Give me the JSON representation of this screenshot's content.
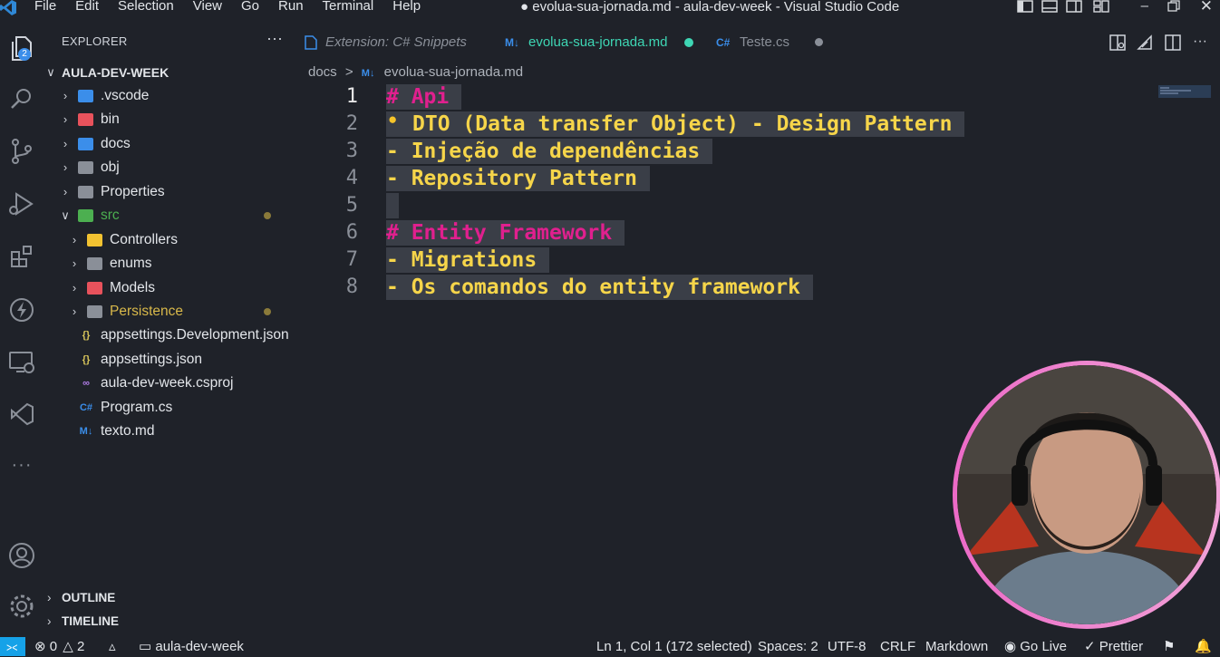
{
  "menu": [
    "File",
    "Edit",
    "Selection",
    "View",
    "Go",
    "Run",
    "Terminal",
    "Help"
  ],
  "window_title": "● evolua-sua-jornada.md - aula-dev-week - Visual Studio Code",
  "activity_badge": "2",
  "explorer": {
    "title": "EXPLORER",
    "more": "···",
    "root": "AULA-DEV-WEEK",
    "items": [
      {
        "label": ".vscode",
        "icon": "vscode-folder-icon",
        "color": "#3b8eea"
      },
      {
        "label": "bin",
        "icon": "bin-folder-icon",
        "color": "#e8525c"
      },
      {
        "label": "docs",
        "icon": "docs-folder-icon",
        "color": "#3b8eea"
      },
      {
        "label": "obj",
        "icon": "folder-icon",
        "color": "#8a8f98"
      },
      {
        "label": "Properties",
        "icon": "folder-icon",
        "color": "#8a8f98"
      },
      {
        "label": "src",
        "icon": "src-folder-icon",
        "color": "#4caf50"
      },
      {
        "label": "Controllers",
        "icon": "controllers-folder-icon",
        "color": "#f2c231"
      },
      {
        "label": "enums",
        "icon": "folder-icon",
        "color": "#8a8f98"
      },
      {
        "label": "Models",
        "icon": "models-folder-icon",
        "color": "#e8525c"
      },
      {
        "label": "Persistence",
        "icon": "folder-icon",
        "color": "#8a8f98"
      },
      {
        "label": "appsettings.Development.json",
        "icon": "json-icon",
        "color": "#d7c45a"
      },
      {
        "label": "appsettings.json",
        "icon": "json-icon",
        "color": "#d7c45a"
      },
      {
        "label": "aula-dev-week.csproj",
        "icon": "csproj-icon",
        "color": "#b27ee8"
      },
      {
        "label": "Program.cs",
        "icon": "csharp-icon",
        "color": "#3b8eea"
      },
      {
        "label": "texto.md",
        "icon": "markdown-icon",
        "color": "#3b8eea"
      }
    ],
    "outline": "OUTLINE",
    "timeline": "TIMELINE"
  },
  "tabs": [
    {
      "label": "Extension: C# Snippets",
      "icon": "extension-file-icon"
    },
    {
      "label": "evolua-sua-jornada.md",
      "icon": "markdown-icon",
      "prefix": "M↓"
    },
    {
      "label": "Teste.cs",
      "icon": "csharp-icon",
      "prefix": "C#"
    }
  ],
  "breadcrumb": {
    "folder": "docs",
    "sep": ">",
    "file": "evolua-sua-jornada.md",
    "prefix": "M↓"
  },
  "editor": {
    "lines": [
      {
        "n": "1",
        "text": "# Api",
        "kind": "heading"
      },
      {
        "n": "2",
        "text": "DTO (Data transfer Object) - Design Pattern",
        "kind": "plain"
      },
      {
        "n": "3",
        "text": "- Injeção de dependências",
        "kind": "plain"
      },
      {
        "n": "4",
        "text": "- Repository Pattern",
        "kind": "plain"
      },
      {
        "n": "5",
        "text": "",
        "kind": "plain"
      },
      {
        "n": "6",
        "text": "# Entity Framework",
        "kind": "heading"
      },
      {
        "n": "7",
        "text": "- Migrations",
        "kind": "plain"
      },
      {
        "n": "8",
        "text": "- Os comandos do entity framework",
        "kind": "plain"
      }
    ]
  },
  "statusbar": {
    "errors": "0",
    "warnings": "2",
    "folder": "aula-dev-week",
    "cursor": "Ln 1, Col 1 (172 selected)",
    "spaces": "Spaces: 2",
    "encoding": "UTF-8",
    "eol": "CRLF",
    "language": "Markdown",
    "golive": "Go Live",
    "prettier": "Prettier"
  },
  "colors": {
    "heading": "#e0208e",
    "text": "#f6d54a",
    "accent": "#16a2e8",
    "modified": "#3ed6b4"
  }
}
